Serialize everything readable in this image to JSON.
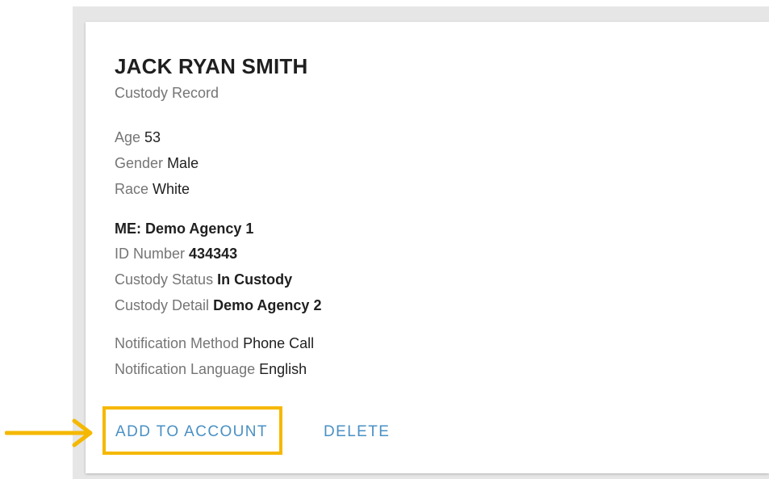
{
  "record": {
    "name": "JACK RYAN SMITH",
    "subtitle": "Custody Record",
    "age_label": "Age",
    "age_value": "53",
    "gender_label": "Gender",
    "gender_value": "Male",
    "race_label": "Race",
    "race_value": "White",
    "agency": "ME: Demo Agency 1",
    "id_label": "ID Number",
    "id_value": "434343",
    "custody_status_label": "Custody Status",
    "custody_status_value": "In Custody",
    "custody_detail_label": "Custody Detail",
    "custody_detail_value": "Demo Agency 2",
    "notification_method_label": "Notification Method",
    "notification_method_value": "Phone Call",
    "notification_language_label": "Notification Language",
    "notification_language_value": "English"
  },
  "actions": {
    "add_label": "ADD TO ACCOUNT",
    "delete_label": "DELETE"
  },
  "colors": {
    "accent": "#4a90c4",
    "highlight": "#f5b800"
  },
  "icons": {
    "pointer_arrow": "arrow-right-icon"
  }
}
